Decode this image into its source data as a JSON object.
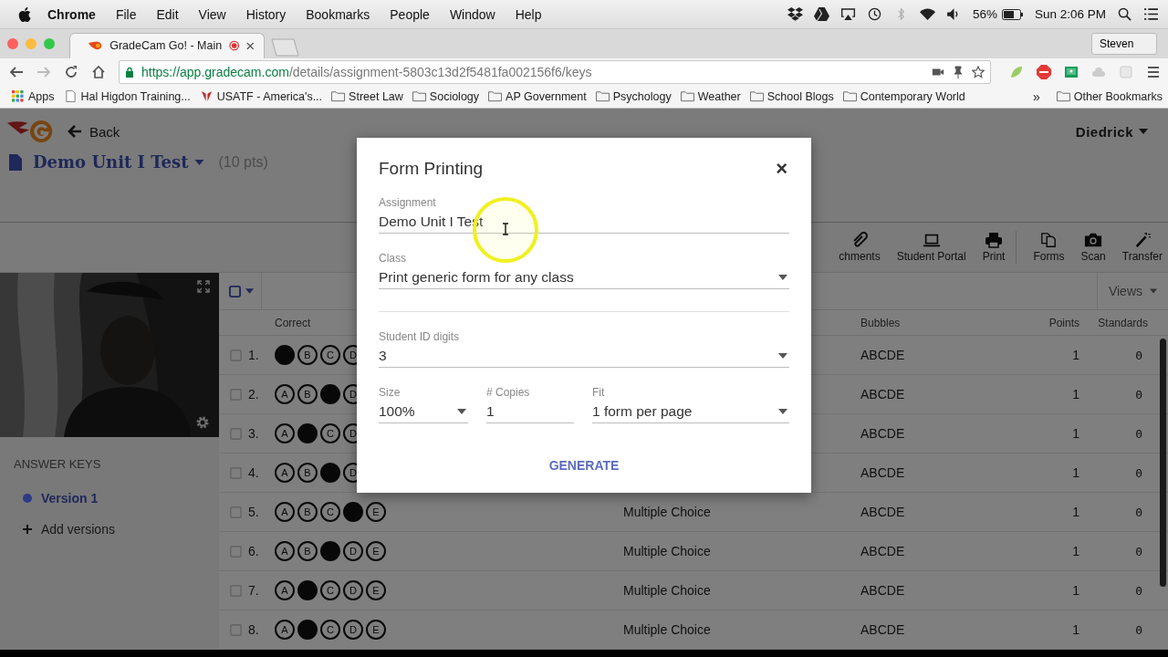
{
  "menubar": {
    "app": "Chrome",
    "menus": [
      "File",
      "Edit",
      "View",
      "History",
      "Bookmarks",
      "People",
      "Window",
      "Help"
    ],
    "battery": "56%",
    "clock": "Sun 2:06 PM"
  },
  "browser": {
    "tabs": [
      {
        "title": "GradeCam Go! - Main",
        "selected": true,
        "recording": true
      }
    ],
    "profile": "Steven",
    "url": {
      "host": "https://app.gradecam.com",
      "path": "/details/assignment-5803c13d2f5481fa002156f6/keys"
    },
    "bookmarks": [
      {
        "label": "Apps",
        "kind": "apps"
      },
      {
        "label": "Hal Higdon Training...",
        "kind": "page"
      },
      {
        "label": "USATF - America's...",
        "kind": "site"
      },
      {
        "label": "Street Law",
        "kind": "folder"
      },
      {
        "label": "Sociology",
        "kind": "folder"
      },
      {
        "label": "AP Government",
        "kind": "folder"
      },
      {
        "label": "Psychology",
        "kind": "folder"
      },
      {
        "label": "Weather",
        "kind": "folder"
      },
      {
        "label": "School Blogs",
        "kind": "folder"
      },
      {
        "label": "Contemporary World",
        "kind": "folder"
      }
    ],
    "overflow": "»",
    "other_bookmarks": "Other Bookmarks"
  },
  "header": {
    "back": "Back",
    "user": "Diedrick",
    "title": "Demo Unit I Test",
    "points": "(10 pts)"
  },
  "toolbar": [
    {
      "label": "chments",
      "kind": "paperclip"
    },
    {
      "label": "Student Portal",
      "kind": "laptop"
    },
    {
      "label": "Print",
      "kind": "printer"
    },
    {
      "label": "Forms",
      "kind": "forms"
    },
    {
      "label": "Scan",
      "kind": "camera"
    },
    {
      "label": "Transfer",
      "kind": "wand"
    }
  ],
  "sidebar": {
    "heading": "ANSWER KEYS",
    "versions": [
      {
        "label": "Version 1",
        "selected": true,
        "color": "#2e3a87"
      }
    ],
    "add": "Add versions"
  },
  "table": {
    "select_all": {
      "checked": false
    },
    "views": "Views",
    "columns": [
      "Correct",
      "Bubbles",
      "Points",
      "Standards"
    ],
    "rows": [
      {
        "number": "1.",
        "checked": false,
        "bubbles": [
          {
            "filled": true
          },
          {
            "letter": "B",
            "filled": false
          },
          {
            "letter": "C",
            "filled": false
          },
          {
            "letter": "D",
            "filled": false
          }
        ],
        "choices": "ABCDE",
        "points": "1",
        "standards": "0"
      },
      {
        "number": "2.",
        "checked": false,
        "bubbles": [
          {
            "letter": "A",
            "filled": false
          },
          {
            "letter": "B",
            "filled": false
          },
          {
            "filled": true
          },
          {
            "letter": "D",
            "filled": false
          }
        ],
        "choices": "ABCDE",
        "points": "1",
        "standards": "0"
      },
      {
        "number": "3.",
        "checked": false,
        "bubbles": [
          {
            "letter": "A",
            "filled": false
          },
          {
            "filled": true
          },
          {
            "letter": "C",
            "filled": false
          },
          {
            "letter": "D",
            "filled": false
          }
        ],
        "choices": "ABCDE",
        "points": "1",
        "standards": "0"
      },
      {
        "number": "4.",
        "checked": false,
        "bubbles": [
          {
            "letter": "A",
            "filled": false
          },
          {
            "letter": "B",
            "filled": false
          },
          {
            "filled": true
          },
          {
            "letter": "D",
            "filled": false
          }
        ],
        "choices": "ABCDE",
        "points": "1",
        "standards": "0"
      },
      {
        "number": "5.",
        "checked": false,
        "bubbles": [
          {
            "letter": "A",
            "filled": false
          },
          {
            "letter": "B",
            "filled": false
          },
          {
            "letter": "C",
            "filled": false
          },
          {
            "filled": true
          },
          {
            "letter": "E",
            "filled": false
          }
        ],
        "type": "Multiple Choice",
        "choices": "ABCDE",
        "points": "1",
        "standards": "0"
      },
      {
        "number": "6.",
        "checked": false,
        "bubbles": [
          {
            "letter": "A",
            "filled": false
          },
          {
            "letter": "B",
            "filled": false
          },
          {
            "filled": true
          },
          {
            "letter": "D",
            "filled": false
          },
          {
            "letter": "E",
            "filled": false
          }
        ],
        "type": "Multiple Choice",
        "choices": "ABCDE",
        "points": "1",
        "standards": "0"
      },
      {
        "number": "7.",
        "checked": false,
        "bubbles": [
          {
            "letter": "A",
            "filled": false
          },
          {
            "filled": true
          },
          {
            "letter": "C",
            "filled": false
          },
          {
            "letter": "D",
            "filled": false
          },
          {
            "letter": "E",
            "filled": false
          }
        ],
        "type": "Multiple Choice",
        "choices": "ABCDE",
        "points": "1",
        "standards": "0"
      },
      {
        "number": "8.",
        "checked": false,
        "bubbles": [
          {
            "letter": "A",
            "filled": false
          },
          {
            "filled": true
          },
          {
            "letter": "C",
            "filled": false
          },
          {
            "letter": "D",
            "filled": false
          },
          {
            "letter": "E",
            "filled": false
          }
        ],
        "type": "Multiple Choice",
        "choices": "ABCDE",
        "points": "1",
        "standards": "0"
      }
    ]
  },
  "dialog": {
    "title": "Form Printing",
    "close": "×",
    "rows": [
      [
        {
          "label": "Assignment",
          "value": "Demo Unit I Test",
          "kind": "text"
        }
      ],
      [
        {
          "label": "Class",
          "value": "Print generic form for any class",
          "kind": "select"
        }
      ],
      [
        {
          "label": "Student ID digits",
          "value": "3",
          "kind": "select"
        }
      ],
      [
        {
          "label": "Size",
          "value": "100%",
          "kind": "select"
        },
        {
          "label": "# Copies",
          "value": "1",
          "kind": "text"
        },
        {
          "label": "Fit",
          "value": "1 form per page",
          "kind": "select"
        }
      ]
    ],
    "button": "GENERATE"
  }
}
